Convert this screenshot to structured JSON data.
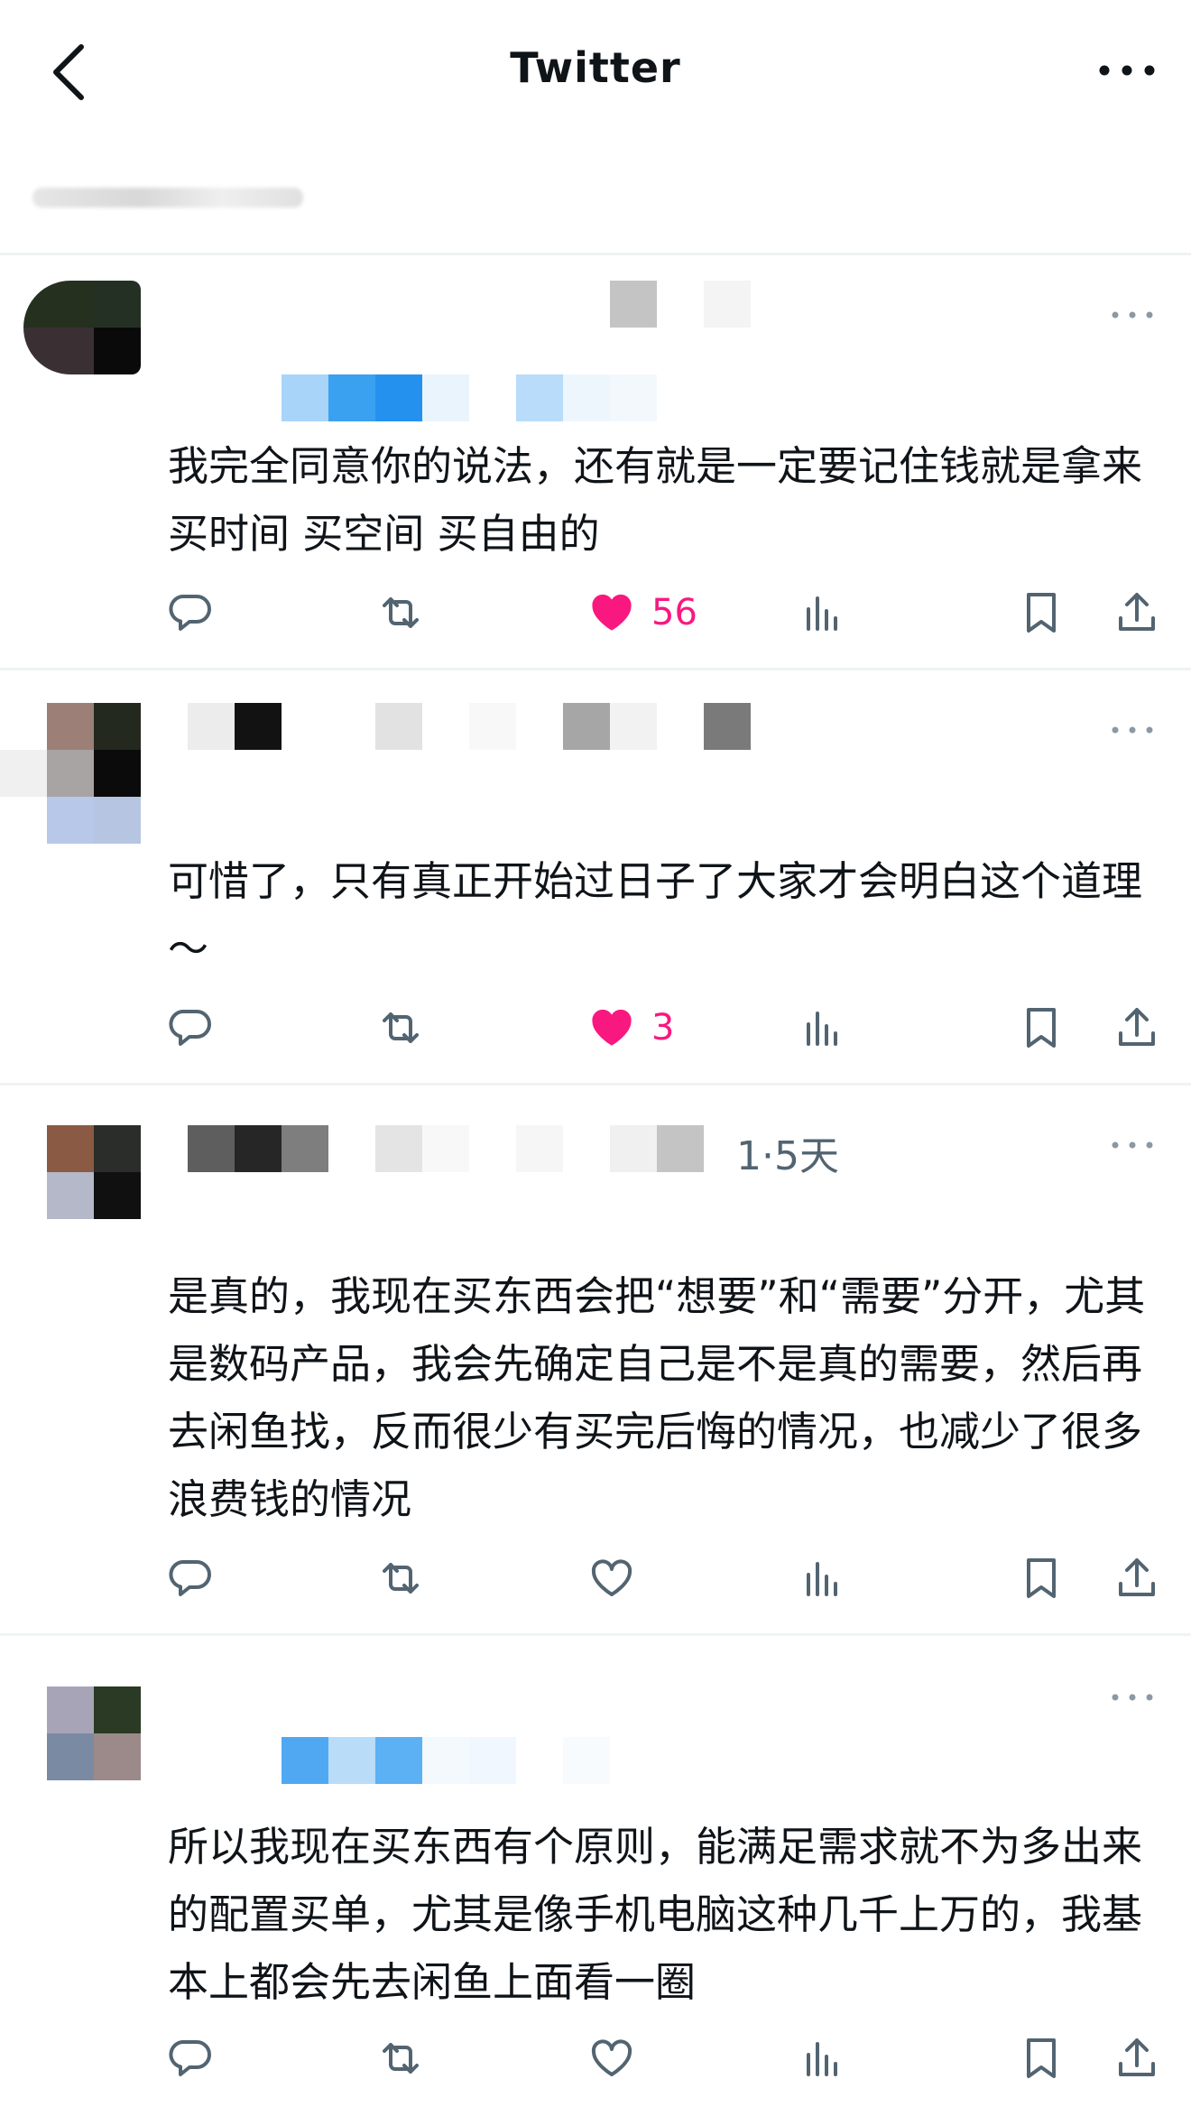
{
  "header": {
    "title": "Twitter"
  },
  "colors": {
    "like_active": "#f91880",
    "icon_gray": "#536471",
    "divider": "#eff3f4"
  },
  "replies": [
    {
      "text": "我完全同意你的说法，还有就是一定要记住钱就是拿来买时间 买空间 买自由的",
      "timestamp": "",
      "liked": true,
      "like_count": "56"
    },
    {
      "text": "可惜了，只有真正开始过日子了大家才会明白这个道理～",
      "timestamp": "",
      "liked": true,
      "like_count": "3"
    },
    {
      "text": "是真的，我现在买东西会把“想要”和“需要”分开，尤其是数码产品，我会先确定自己是不是真的需要，然后再去闲鱼找，反而很少有买完后悔的情况，也减少了很多浪费钱的情况",
      "timestamp": "1·5天",
      "liked": false,
      "like_count": ""
    },
    {
      "text": "所以我现在买东西有个原则，能满足需求就不为多出来的配置买单，尤其是像手机电脑这种几千上万的，我基本上都会先去闲鱼上面看一圈",
      "timestamp": "",
      "liked": false,
      "like_count": ""
    }
  ],
  "icons": {
    "back": "chevron-left-icon",
    "more": "more-horizontal-icon",
    "reply": "reply-bubble-icon",
    "retweet": "retweet-icon",
    "like": "heart-icon",
    "views": "views-chart-icon",
    "bookmark": "bookmark-icon",
    "share": "share-icon"
  }
}
